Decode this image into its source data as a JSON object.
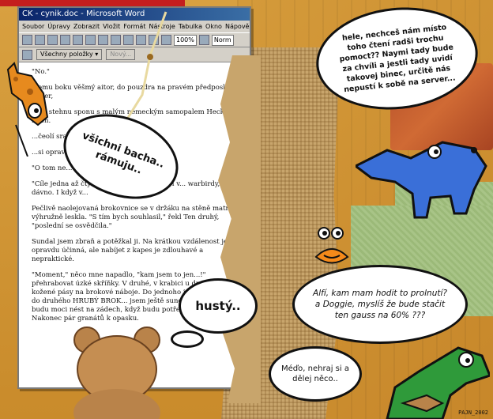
{
  "window": {
    "title": "CK - cynik.doc - Microsoft Word",
    "menu": [
      "Soubor",
      "Úpravy",
      "Zobrazit",
      "Vložit",
      "Formát",
      "Nástroje",
      "Tabulka",
      "Okno",
      "Nápověda"
    ],
    "zoom": "100%",
    "style": "Norm",
    "dropdown_label": "Všechny položky ▾",
    "dropdown2_label": "Nový..."
  },
  "document": {
    "paragraphs": [
      "\"No.\"",
      "...emu boku věšmý aitor, do pouzdra na pravém předposlední ... her,",
      "...nu stehnu sponu s malým německým samopalem Heckler-Koch.",
      "...čeolí srazil ...",
      "...si opravo...",
      "\"O tom ne...",
      "\"Cíle jedna až čtyři v... ...řeme už jen čtyři v... warbirdy, vím dávno. I když v...",
      "Pečlivě naolejovaná brokovnice se v držáku na stěně matně a výhružně leskla. \"S tím bych souhlasil,\" řekl Ten druhý, \"poslední se osvědčila.\"",
      "Sundal jsem zbraň a potěžkal ji. Na krátkou vzdálenost je opravdu účinná, ale nabíjet z kapes je zdlouhavé a nepraktické.",
      "\"Moment,\" něco mne napadlo, \"kam jsem to jen...!\" přehrabovat úzké skříňky. V druhé, v krabici u dna, dva kožené pásy na brokové náboje. Do jednoho jsem ... BROK, do druhého HRUBÝ BROK... jsem ještě sundal ... - pušku tak budu moci nést na zádech, když budu potřebovat ruce volné. Nakonec pár granátů k opasku."
    ]
  },
  "bubbles": {
    "top_right": "hele, nechceš nám místo toho čtení radši trochu pomoct?? Naymi tady bude za chvíli a jestli tady uvidí takovej binec, určitě nás nepustí k sobě na server...",
    "left": "všichni bacha.. rámuju..",
    "middle": "hustý..",
    "bottom_right": "Alfí, kam mam hodit to prolnutí? a Doggie, myslíš že bude stačit ten gauss na 60% ???",
    "bottom": "Méďo, nehraj si a dělej něco.."
  },
  "signature": "PAJN_2002",
  "colors": {
    "titlebar": "#0a246a",
    "blue_critter": "#3a6fd8",
    "giraffe": "#e78a1e",
    "dino": "#2f9a3a",
    "bear": "#b9834a"
  }
}
